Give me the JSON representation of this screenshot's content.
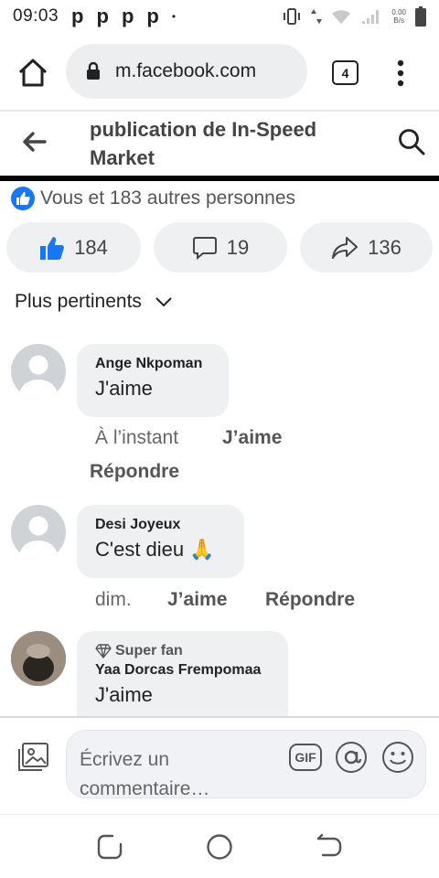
{
  "status_bar": {
    "time": "09:03",
    "notification_letters": [
      "p",
      "p",
      "p",
      "p"
    ],
    "dot": "•",
    "net_speed_value": "0.00",
    "net_speed_unit": "B/s"
  },
  "browser": {
    "url": "m.facebook.com",
    "tab_count": "4"
  },
  "fb_header": {
    "title_line1": "publication de In-Speed",
    "title_line2": "Market"
  },
  "reactions": {
    "summary": "Vous et 183 autres personnes",
    "likes": "184",
    "comments": "19",
    "shares": "136"
  },
  "sort": {
    "label": "Plus pertinents"
  },
  "comments": [
    {
      "name": "Ange Nkpoman",
      "text": "J'aime",
      "time": "À l’instant",
      "like_label": "J’aime",
      "reply_label": "Répondre"
    },
    {
      "name": "Desi Joyeux",
      "text": "C'est dieu 🙏",
      "time": "dim.",
      "like_label": "J’aime",
      "reply_label": "Répondre"
    },
    {
      "badge": "Super fan",
      "name": "Yaa Dorcas Frempomaa",
      "text": "J'aime"
    }
  ],
  "composer": {
    "placeholder": "Écrivez un commentaire…",
    "gif_label": "GIF"
  },
  "colors": {
    "accent": "#1877f2",
    "pill_bg": "#eef0f2",
    "text_muted": "#666666"
  }
}
